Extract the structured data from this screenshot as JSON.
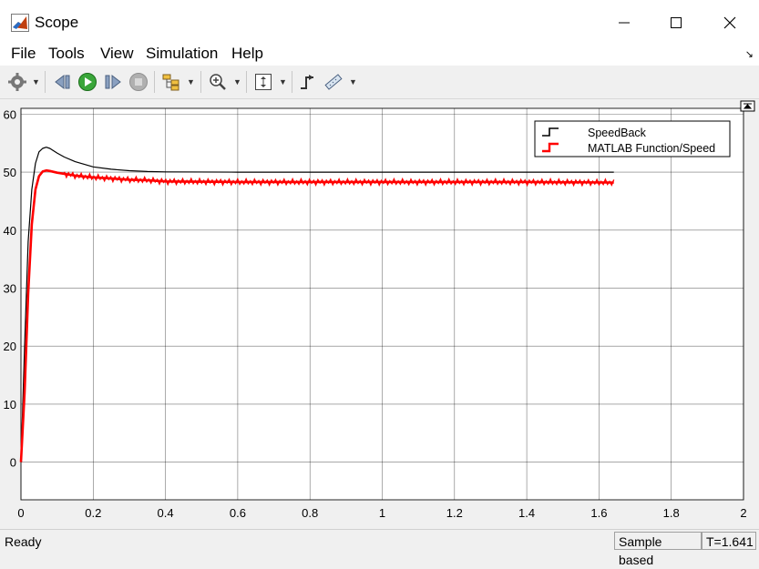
{
  "window": {
    "title": "Scope"
  },
  "menu": {
    "items": [
      "File",
      "Tools",
      "View",
      "Simulation",
      "Help"
    ]
  },
  "toolbar": {
    "buttons": [
      "settings-icon",
      "step-back-icon",
      "run-icon",
      "step-forward-icon",
      "stop-icon",
      "signal-tree-icon",
      "zoom-in-icon",
      "fit-axes-icon",
      "triggers-icon",
      "cursor-measurements-icon"
    ]
  },
  "chart_data": {
    "type": "line",
    "xlim": [
      0,
      2
    ],
    "ylim": [
      -6.5,
      61
    ],
    "xticks": [
      "0",
      "0.2",
      "0.4",
      "0.6",
      "0.8",
      "1",
      "1.2",
      "1.4",
      "1.6",
      "1.8",
      "2"
    ],
    "yticks": [
      "0",
      "10",
      "20",
      "30",
      "40",
      "50",
      "60"
    ],
    "grid": true,
    "legend_position": "top-right",
    "series": [
      {
        "name": "SpeedBack",
        "color": "#000000",
        "x": [
          0,
          0.01,
          0.02,
          0.03,
          0.04,
          0.05,
          0.06,
          0.07,
          0.08,
          0.1,
          0.12,
          0.15,
          0.2,
          0.25,
          0.3,
          0.35,
          0.4,
          0.6,
          1.0,
          1.4,
          1.641
        ],
        "y": [
          0,
          20,
          38,
          47,
          51.5,
          53.5,
          54.1,
          54.3,
          54.1,
          53.3,
          52.6,
          51.8,
          50.9,
          50.5,
          50.25,
          50.1,
          50.05,
          50,
          50,
          50,
          50
        ]
      },
      {
        "name": "MATLAB Function/Speed",
        "color": "#ff0000",
        "x": [
          0,
          0.01,
          0.02,
          0.03,
          0.04,
          0.05,
          0.06,
          0.07,
          0.08,
          0.1,
          0.15,
          0.2,
          0.25,
          0.3,
          0.35,
          0.4,
          0.6,
          1.0,
          1.4,
          1.641
        ],
        "y": [
          0,
          12,
          29,
          41,
          47,
          49.3,
          50.1,
          50.3,
          50.2,
          49.9,
          49.4,
          49.1,
          48.9,
          48.7,
          48.6,
          48.4,
          48.3,
          48.3,
          48.3,
          48.2
        ]
      }
    ]
  },
  "status": {
    "left": "Ready",
    "sample_mode": "Sample based",
    "time": "T=1.641"
  }
}
